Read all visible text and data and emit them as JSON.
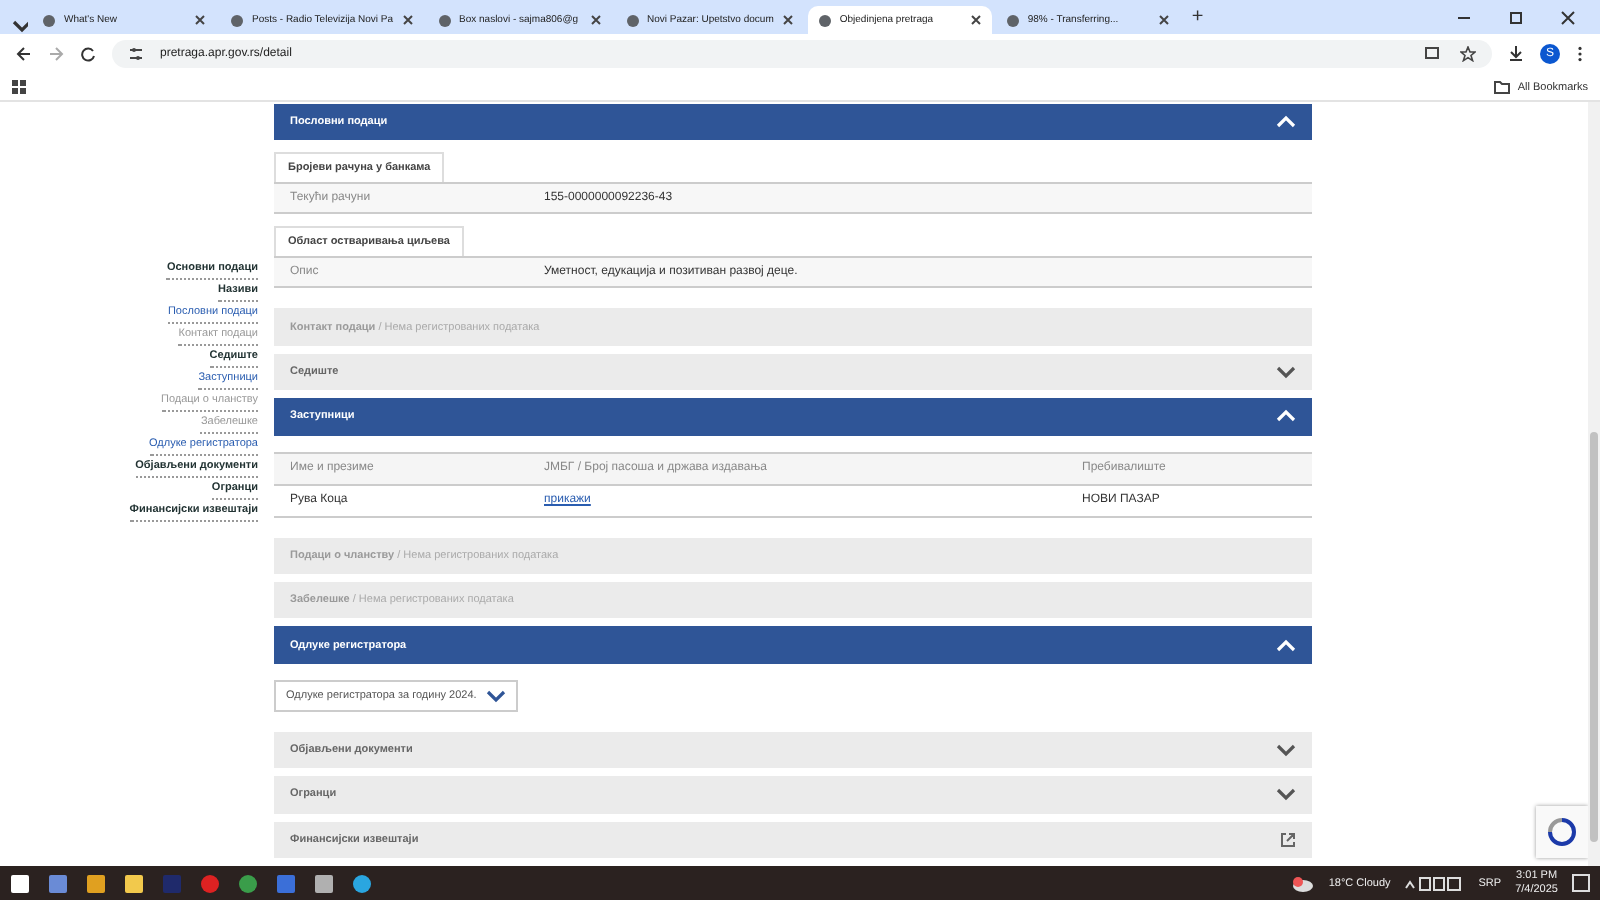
{
  "browser": {
    "tabs": [
      {
        "title": "What's New",
        "selected": false
      },
      {
        "title": "Posts - Radio Televizija Novi Pa",
        "selected": false
      },
      {
        "title": "Box naslovi - sajma806@g",
        "selected": false
      },
      {
        "title": "Novi Pazar: Upetstvo docum",
        "selected": false
      },
      {
        "title": "Objedinjena pretraga",
        "selected": true
      },
      {
        "title": "98% - Transferring...",
        "selected": false
      }
    ],
    "new_tab": "+",
    "address": "pretraga.apr.gov.rs/detail",
    "bookmarks_label": "All Bookmarks",
    "profile_initial": "S"
  },
  "sidebar": {
    "items": [
      {
        "label": "Основни подаци",
        "kind": "bold"
      },
      {
        "label": "Називи",
        "kind": "bold"
      },
      {
        "label": "Пословни подаци",
        "kind": "link"
      },
      {
        "label": "Контакт подаци",
        "kind": "muted"
      },
      {
        "label": "Седиште",
        "kind": "bold"
      },
      {
        "label": "Заступници",
        "kind": "link"
      },
      {
        "label": "Подаци о чланству",
        "kind": "muted"
      },
      {
        "label": "Забелешке",
        "kind": "muted"
      },
      {
        "label": "Одлуке регистратора",
        "kind": "link"
      },
      {
        "label": "Објављени документи",
        "kind": "bold"
      },
      {
        "label": "Огранци",
        "kind": "bold"
      },
      {
        "label": "Финансијски извештаји",
        "kind": "bold"
      }
    ]
  },
  "sections": [
    {
      "title": "Пословни подаци",
      "expanded": true,
      "content": {
        "kind": "groups",
        "groups": [
          {
            "tab": "Бројеви рачуна у банкама",
            "rows": [
              {
                "label": "Текући рачуни",
                "value": "155-0000000092236-43"
              }
            ]
          },
          {
            "tab": "Област остваривања циљева",
            "rows": [
              {
                "label": "Опис",
                "value": "Уметност, едукација и позитиван развој деце."
              }
            ]
          }
        ]
      }
    },
    {
      "title": "Контакт подаци",
      "note": "/ Нема регистрованих података",
      "expanded": false
    },
    {
      "title": "Седиште",
      "expanded": false
    },
    {
      "title": "Заступници",
      "expanded": true,
      "content": {
        "kind": "table",
        "columns": [
          "Име и презиме",
          "ЈМБГ / Број пасоша и држава издавања",
          "Пребивалиште"
        ],
        "rows": [
          {
            "name": "Рува Коца",
            "id_link": "прикажи",
            "residence": "НОВИ ПАЗАР"
          }
        ]
      }
    },
    {
      "title": "Подаци о чланству",
      "note": "/ Нема регистрованих података",
      "expanded": false
    },
    {
      "title": "Забелешке",
      "note": "/ Нема регистрованих података",
      "expanded": false
    },
    {
      "title": "Одлуке регистратора",
      "expanded": true,
      "content": {
        "kind": "select",
        "value": "Одлуке регистратора за годину 2024."
      }
    },
    {
      "title": "Објављени документи",
      "expanded": false
    },
    {
      "title": "Огранци",
      "expanded": false
    },
    {
      "title": "Финансијски извештаји",
      "expanded": false,
      "external": true
    }
  ],
  "taskbar": {
    "weather": "18°C  Cloudy",
    "language": "SRP",
    "time": "3:01 PM",
    "date": "7/4/2025"
  }
}
